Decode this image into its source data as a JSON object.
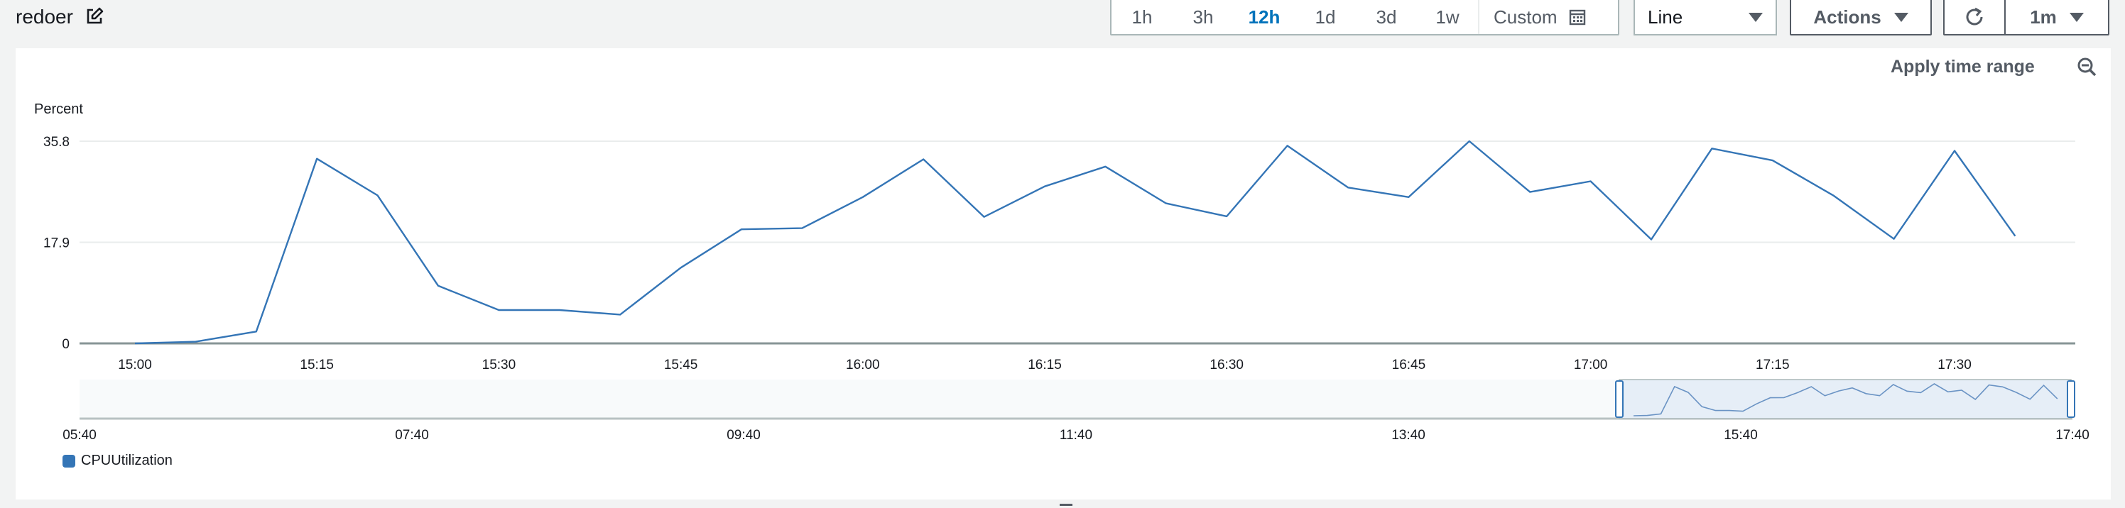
{
  "widget": {
    "title": "redoer"
  },
  "toolbar": {
    "time_ranges": [
      "1h",
      "3h",
      "12h",
      "1d",
      "3d",
      "1w"
    ],
    "active_range": "12h",
    "custom_label": "Custom",
    "chart_type_select": "Line",
    "actions_label": "Actions",
    "refresh_interval": "1m",
    "apply_time_range": "Apply time range"
  },
  "colors": {
    "series": "#3475b6",
    "accent": "#0073bb"
  },
  "chart_data": {
    "type": "line",
    "ylabel": "Percent",
    "ylim": [
      0,
      35.8
    ],
    "y_ticks": [
      "0",
      "17.9",
      "35.8"
    ],
    "x_ticks": [
      "15:00",
      "15:15",
      "15:30",
      "15:45",
      "16:00",
      "16:15",
      "16:30",
      "16:45",
      "17:00",
      "17:15",
      "17:30"
    ],
    "x_tick_minutes": [
      0,
      15,
      30,
      45,
      60,
      75,
      90,
      105,
      120,
      135,
      150
    ],
    "series": [
      {
        "name": "CPUUtilization",
        "color": "#3475b6",
        "x_minutes": [
          0,
          5,
          10,
          15,
          20,
          25,
          30,
          35,
          40,
          45,
          50,
          55,
          60,
          65,
          70,
          75,
          80,
          85,
          90,
          95,
          100,
          105,
          110,
          115,
          120,
          125,
          130,
          135,
          140,
          145,
          150,
          155
        ],
        "values": [
          0,
          0.3,
          2.1,
          32.7,
          26.2,
          10.2,
          5.9,
          5.9,
          5.1,
          13.4,
          20.2,
          20.4,
          25.9,
          32.6,
          22.4,
          27.8,
          31.3,
          24.8,
          22.5,
          35.0,
          27.6,
          25.9,
          35.8,
          26.8,
          28.7,
          18.4,
          34.5,
          32.4,
          26.2,
          18.5,
          34.1,
          19.0
        ]
      }
    ],
    "overview": {
      "x_ticks": [
        "05:40",
        "07:40",
        "09:40",
        "11:40",
        "13:40",
        "15:40",
        "17:40"
      ],
      "selected_range": [
        "15:00",
        "17:40"
      ]
    },
    "legend": [
      "CPUUtilization"
    ]
  }
}
